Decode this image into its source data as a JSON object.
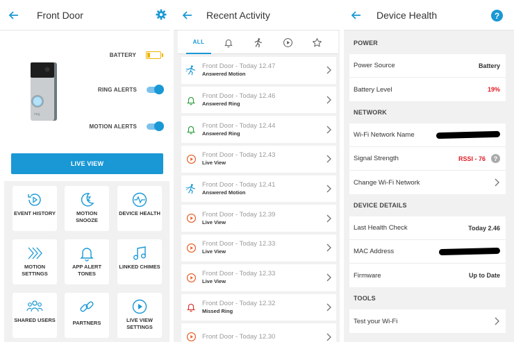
{
  "screens": {
    "front_door": {
      "title": "Front Door",
      "status": {
        "battery_label": "BATTERY",
        "battery_level_fraction": 0.2,
        "ring_alerts_label": "RING ALERTS",
        "ring_alerts_on": true,
        "motion_alerts_label": "MOTION ALERTS",
        "motion_alerts_on": true
      },
      "live_view_label": "LIVE VIEW",
      "tiles": [
        {
          "label": "EVENT HISTORY",
          "icon": "event-history-icon"
        },
        {
          "label": "MOTION SNOOZE",
          "icon": "motion-snooze-icon"
        },
        {
          "label": "DEVICE HEALTH",
          "icon": "device-health-icon"
        },
        {
          "label": "MOTION SETTINGS",
          "icon": "motion-settings-icon"
        },
        {
          "label": "APP ALERT TONES",
          "icon": "bell-icon"
        },
        {
          "label": "LINKED CHIMES",
          "icon": "music-note-icon"
        },
        {
          "label": "SHARED USERS",
          "icon": "users-icon"
        },
        {
          "label": "PARTNERS",
          "icon": "link-icon"
        },
        {
          "label": "LIVE VIEW SETTINGS",
          "icon": "play-icon"
        }
      ]
    },
    "recent_activity": {
      "title": "Recent Activity",
      "tabs": {
        "all": "ALL"
      },
      "events": [
        {
          "title": "Front Door - Today 12.47",
          "subtitle": "Answered Motion",
          "type": "motion"
        },
        {
          "title": "Front Door - Today 12.46",
          "subtitle": "Answered Ring",
          "type": "ring"
        },
        {
          "title": "Front Door - Today 12.44",
          "subtitle": "Answered Ring",
          "type": "ring"
        },
        {
          "title": "Front Door - Today 12.43",
          "subtitle": "Live View",
          "type": "live"
        },
        {
          "title": "Front Door - Today 12.41",
          "subtitle": "Answered Motion",
          "type": "motion"
        },
        {
          "title": "Front Door - Today 12.39",
          "subtitle": "Live View",
          "type": "live"
        },
        {
          "title": "Front Door - Today 12.33",
          "subtitle": "Live View",
          "type": "live"
        },
        {
          "title": "Front Door - Today 12.33",
          "subtitle": "Live View",
          "type": "live"
        },
        {
          "title": "Front Door - Today 12.32",
          "subtitle": "Missed Ring",
          "type": "missed"
        },
        {
          "title": "Front Door - Today 12.30",
          "subtitle": "",
          "type": "live"
        }
      ]
    },
    "device_health": {
      "title": "Device Health",
      "power": {
        "header": "POWER",
        "source_label": "Power Source",
        "source_value": "Battery",
        "level_label": "Battery Level",
        "level_value": "19%"
      },
      "network": {
        "header": "NETWORK",
        "wifi_name_label": "Wi-Fi Network Name",
        "signal_label": "Signal Strength",
        "signal_value": "RSSI - 76",
        "help_glyph": "?",
        "change_label": "Change Wi-Fi Network"
      },
      "details": {
        "header": "DEVICE DETAILS",
        "last_check_label": "Last Health Check",
        "last_check_value": "Today 2.46",
        "mac_label": "MAC Address",
        "firmware_label": "Firmware",
        "firmware_value": "Up to Date"
      },
      "tools": {
        "header": "TOOLS",
        "test_wifi_label": "Test your Wi-Fi"
      }
    }
  },
  "colors": {
    "accent": "#1998d5",
    "ring_green": "#2e9e3e",
    "live_orange": "#e8622d",
    "missed_red": "#d9342b",
    "alert_red": "#e01b24",
    "battery_yellow": "#f0b400"
  }
}
